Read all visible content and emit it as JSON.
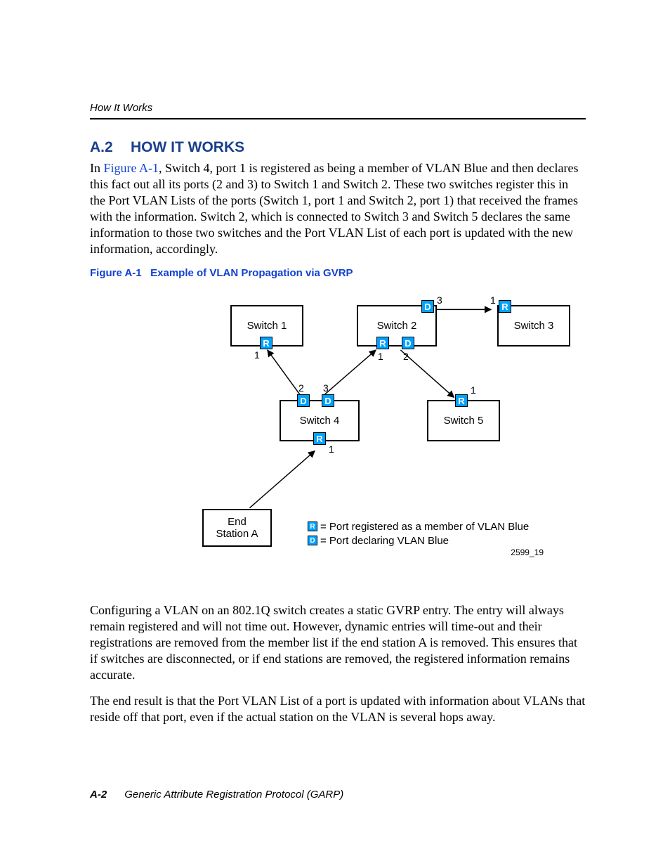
{
  "header": {
    "running": "How It Works"
  },
  "section": {
    "num": "A.2",
    "title": "HOW IT WORKS",
    "intro_pre": "In ",
    "intro_link": "Figure A-1",
    "intro_post": ", Switch 4, port 1 is registered as being a member of VLAN Blue and then declares this fact out all its ports (2 and 3) to Switch 1 and Switch 2. These two switches register this in the Port VLAN Lists of the ports (Switch 1, port 1 and Switch 2, port 1) that received the frames with the information. Switch 2, which is connected to Switch 3 and Switch 5 declares the same information to those two switches and the Port VLAN List of each port is updated with the new information, accordingly."
  },
  "figure": {
    "label": "Figure A-1",
    "title": "Example of VLAN Propagation via GVRP",
    "switches": {
      "s1": "Switch 1",
      "s2": "Switch 2",
      "s3": "Switch 3",
      "s4": "Switch 4",
      "s5": "Switch 5",
      "endA_l1": "End",
      "endA_l2": "Station A"
    },
    "tags": {
      "R": "R",
      "D": "D"
    },
    "ports": {
      "1": "1",
      "2": "2",
      "3": "3"
    },
    "legend": {
      "r": " = Port registered as a member of VLAN Blue",
      "d": " = Port declaring VLAN Blue"
    },
    "id": "2599_19"
  },
  "paras": {
    "p2": "Configuring a VLAN on an 802.1Q switch creates a static GVRP entry. The entry will always remain registered and will not time out. However, dynamic entries will time-out and their registrations are removed from the member list if the end station A is removed. This ensures that if switches are disconnected, or if end stations are removed, the registered information remains accurate.",
    "p3": "The end result is that the Port VLAN List of a port is updated with information about VLANs that reside off that port, even if the actual station on the VLAN is several hops away."
  },
  "footer": {
    "page": "A-2",
    "title": "Generic Attribute Registration Protocol (GARP)"
  }
}
